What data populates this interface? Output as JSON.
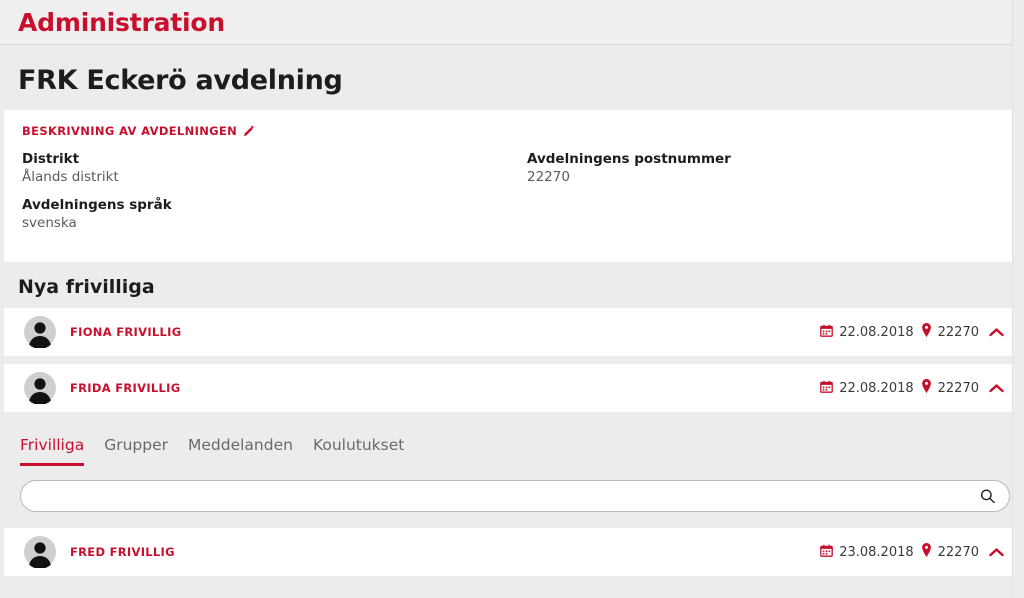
{
  "header": {
    "title": "Administration"
  },
  "unit": {
    "title": "FRK Eckerö avdelning"
  },
  "description": {
    "heading": "BESKRIVNING AV AVDELNINGEN",
    "edit_icon": "pencil-icon",
    "fields_left": [
      {
        "label": "Distrikt",
        "value": "Ålands distrikt"
      },
      {
        "label": "Avdelningens språk",
        "value": "svenska"
      }
    ],
    "fields_right": [
      {
        "label": "Avdelningens postnummer",
        "value": "22270"
      }
    ]
  },
  "new_volunteers": {
    "heading": "Nya frivilliga",
    "rows": [
      {
        "avatar": "person-avatar",
        "name": "FIONA FRIVILLIG",
        "calendar_icon": "calendar-icon",
        "date": "22.08.2018",
        "pin_icon": "map-pin-icon",
        "zip": "22270",
        "chevron": "chevron-up-icon"
      },
      {
        "avatar": "person-avatar",
        "name": "FRIDA FRIVILLIG",
        "calendar_icon": "calendar-icon",
        "date": "22.08.2018",
        "pin_icon": "map-pin-icon",
        "zip": "22270",
        "chevron": "chevron-up-icon"
      }
    ]
  },
  "tabs": [
    {
      "label": "Frivilliga",
      "active": true
    },
    {
      "label": "Grupper",
      "active": false
    },
    {
      "label": "Meddelanden",
      "active": false
    },
    {
      "label": "Koulutukset",
      "active": false
    }
  ],
  "search": {
    "value": "",
    "placeholder": "",
    "icon": "search-icon"
  },
  "volunteer_list": {
    "rows": [
      {
        "avatar": "person-avatar",
        "name": "FRED FRIVILLIG",
        "calendar_icon": "calendar-icon",
        "date": "23.08.2018",
        "pin_icon": "map-pin-icon",
        "zip": "22270",
        "chevron": "chevron-up-icon"
      }
    ]
  },
  "colors": {
    "brand_red": "#c8102e",
    "page_bg": "#ececec",
    "card_bg": "#ffffff",
    "text_dark": "#1d1d1d",
    "text_muted": "#5b5b5b"
  }
}
